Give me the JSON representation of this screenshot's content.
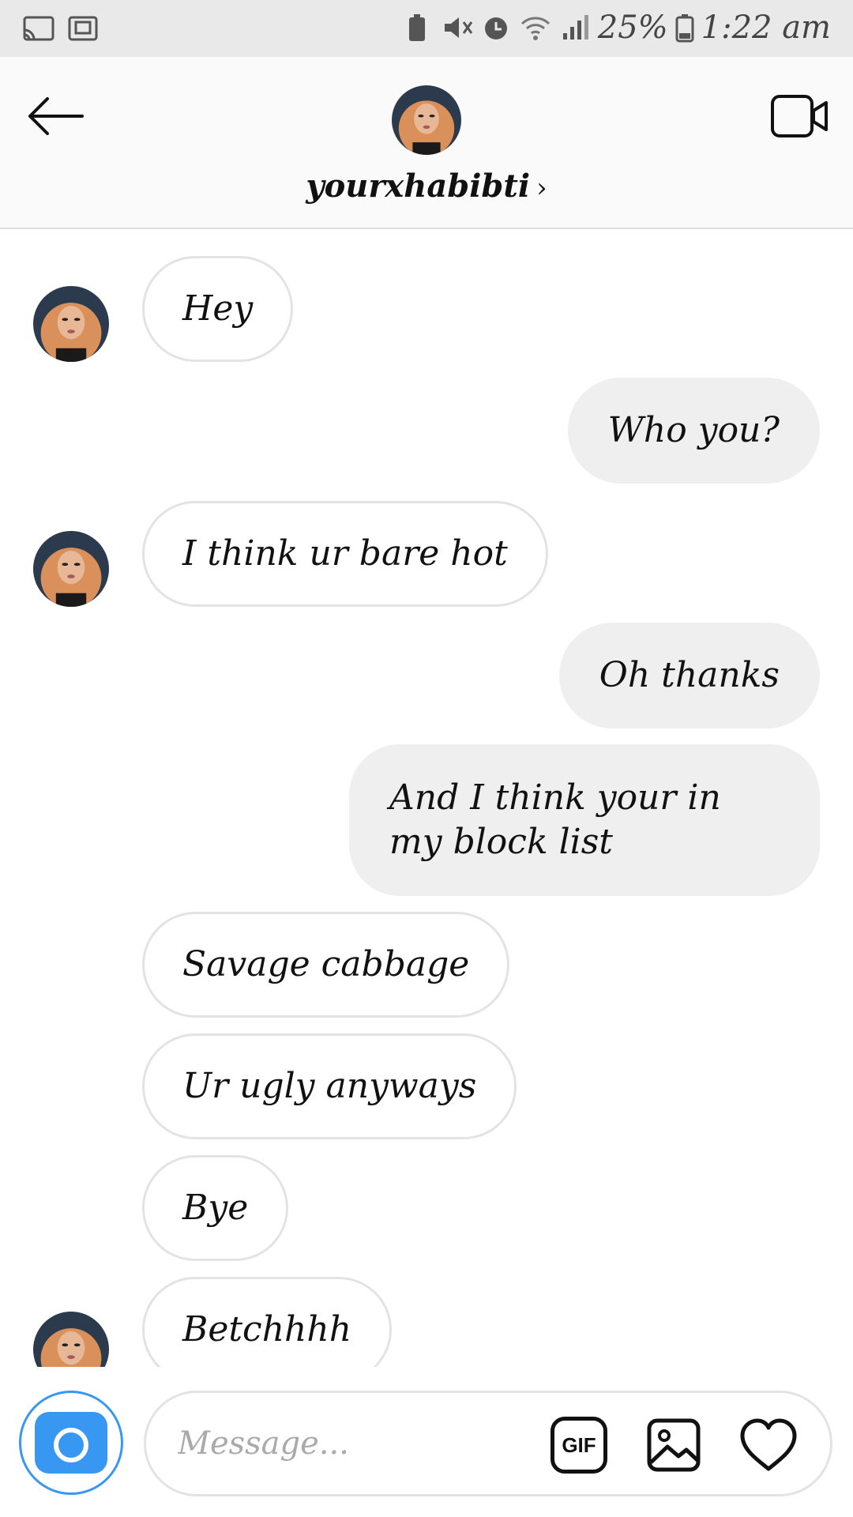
{
  "status_bar": {
    "battery": "25%",
    "time": "1:22 am"
  },
  "header": {
    "username": "yourxhabibti",
    "chevron": "›",
    "icons": {
      "back": "arrow-left-icon",
      "video": "video-camera-icon"
    }
  },
  "messages": [
    {
      "dir": "in",
      "text": "Hey"
    },
    {
      "dir": "out",
      "text": "Who you?"
    },
    {
      "dir": "in",
      "text": "I think ur bare hot"
    },
    {
      "dir": "out",
      "text": "Oh thanks"
    },
    {
      "dir": "out",
      "text": "And I think your in my block list"
    },
    {
      "dir": "in",
      "text": "Savage cabbage"
    },
    {
      "dir": "in",
      "text": "Ur ugly anyways"
    },
    {
      "dir": "in",
      "text": "Bye"
    },
    {
      "dir": "in",
      "text": "Betchhhh"
    }
  ],
  "composer": {
    "placeholder": "Message...",
    "gif_label": "GIF",
    "icons": {
      "camera": "camera-icon",
      "gallery": "image-icon",
      "like": "heart-icon"
    }
  },
  "colors": {
    "accent": "#3897f0",
    "incoming_border": "#e3e3e3",
    "outgoing_fill": "#efefef"
  }
}
